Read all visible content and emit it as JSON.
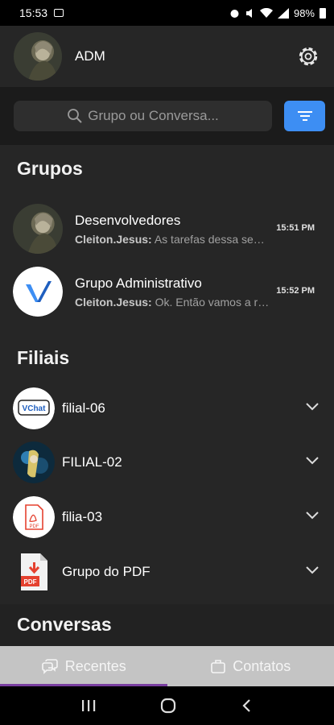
{
  "status_bar": {
    "time": "15:53",
    "battery": "98%"
  },
  "header": {
    "user_name": "ADM"
  },
  "search": {
    "placeholder": "Grupo ou Conversa..."
  },
  "groups": {
    "title": "Grupos",
    "items": [
      {
        "name": "Desenvolvedores",
        "sender": "Cleiton.Jesus:",
        "message": "As tarefas dessa semana",
        "time": "15:51 PM"
      },
      {
        "name": "Grupo Administrativo",
        "sender": "Cleiton.Jesus:",
        "message": "Ok. Então vamos a reunião",
        "time": "15:52 PM"
      }
    ]
  },
  "branches": {
    "title": "Filiais",
    "items": [
      {
        "name": "filial-06",
        "logo_text": "VChat"
      },
      {
        "name": "FILIAL-02"
      },
      {
        "name": "filia-03",
        "logo_text": "PDF"
      },
      {
        "name": "Grupo do PDF",
        "logo_text": "PDF"
      }
    ]
  },
  "conversations": {
    "title": "Conversas"
  },
  "bottom_nav": {
    "recent_label": "Recentes",
    "contacts_label": "Contatos"
  },
  "colors": {
    "accent": "#3d8ef3",
    "active_tab_indicator": "#7a3fa0",
    "pdf_red": "#e5412f"
  }
}
